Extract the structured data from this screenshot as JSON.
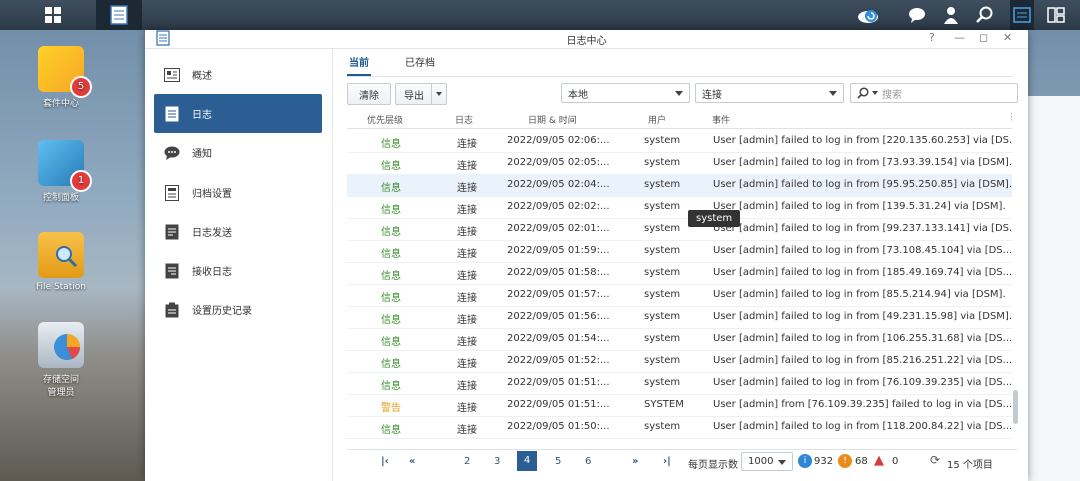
{
  "desktop": {
    "icons": [
      {
        "label": "套件中心",
        "badge": "5"
      },
      {
        "label": "控制面板",
        "badge": "1"
      },
      {
        "label": "File Station",
        "badge": ""
      },
      {
        "label": "存储空间\n管理员",
        "badge": ""
      }
    ]
  },
  "window": {
    "title": "日志中心",
    "sidebar": [
      {
        "label": "概述",
        "icon": "overview-icon"
      },
      {
        "label": "日志",
        "icon": "log-icon"
      },
      {
        "label": "通知",
        "icon": "chat-icon"
      },
      {
        "label": "归档设置",
        "icon": "archive-icon"
      },
      {
        "label": "日志发送",
        "icon": "send-icon"
      },
      {
        "label": "接收日志",
        "icon": "receive-icon"
      },
      {
        "label": "设置历史记录",
        "icon": "history-icon"
      }
    ],
    "tabs": [
      "当前",
      "已存档"
    ],
    "toolbar": {
      "clear_label": "清除",
      "export_label": "导出",
      "source_value": "本地",
      "type_value": "连接",
      "search_placeholder": "搜索"
    },
    "columns": [
      "优先层级",
      "日志",
      "日期 & 时间",
      "用户",
      "事件"
    ],
    "rows": [
      {
        "level": "信息",
        "log": "连接",
        "time": "2022/09/05 02:06:...",
        "user": "system",
        "event": "User [admin] failed to log in from [220.135.60.253] via [DS..."
      },
      {
        "level": "信息",
        "log": "连接",
        "time": "2022/09/05 02:05:...",
        "user": "system",
        "event": "User [admin] failed to log in from [73.93.39.154] via [DSM]."
      },
      {
        "level": "信息",
        "log": "连接",
        "time": "2022/09/05 02:04:...",
        "user": "system",
        "event": "User [admin] failed to log in from [95.95.250.85] via [DSM]."
      },
      {
        "level": "信息",
        "log": "连接",
        "time": "2022/09/05 02:02:...",
        "user": "system",
        "event": "User [admin] failed to log in from [139.5.31.24] via [DSM]."
      },
      {
        "level": "信息",
        "log": "连接",
        "time": "2022/09/05 02:01:...",
        "user": "system",
        "event": "User [admin] failed to log in from [99.237.133.141] via [DS..."
      },
      {
        "level": "信息",
        "log": "连接",
        "time": "2022/09/05 01:59:...",
        "user": "system",
        "event": "User [admin] failed to log in from [73.108.45.104] via [DS..."
      },
      {
        "level": "信息",
        "log": "连接",
        "time": "2022/09/05 01:58:...",
        "user": "system",
        "event": "User [admin] failed to log in from [185.49.169.74] via [DS..."
      },
      {
        "level": "信息",
        "log": "连接",
        "time": "2022/09/05 01:57:...",
        "user": "system",
        "event": "User [admin] failed to log in from [85.5.214.94] via [DSM]."
      },
      {
        "level": "信息",
        "log": "连接",
        "time": "2022/09/05 01:56:...",
        "user": "system",
        "event": "User [admin] failed to log in from [49.231.15.98] via [DSM]."
      },
      {
        "level": "信息",
        "log": "连接",
        "time": "2022/09/05 01:54:...",
        "user": "system",
        "event": "User [admin] failed to log in from [106.255.31.68] via [DS..."
      },
      {
        "level": "信息",
        "log": "连接",
        "time": "2022/09/05 01:52:...",
        "user": "system",
        "event": "User [admin] failed to log in from [85.216.251.22] via [DS..."
      },
      {
        "level": "信息",
        "log": "连接",
        "time": "2022/09/05 01:51:...",
        "user": "system",
        "event": "User [admin] failed to log in from [76.109.39.235] via [DS..."
      },
      {
        "level": "警告",
        "log": "连接",
        "time": "2022/09/05 01:51:...",
        "user": "SYSTEM",
        "event": "User [admin] from [76.109.39.235] failed to log in via [DS..."
      },
      {
        "level": "信息",
        "log": "连接",
        "time": "2022/09/05 01:50:...",
        "user": "system",
        "event": "User [admin] failed to log in from [118.200.84.22] via [DS..."
      }
    ],
    "tooltip": "system",
    "pager": {
      "pages": [
        "2",
        "3",
        "4",
        "5",
        "6"
      ],
      "current": "4",
      "per_page_label": "每页显示数",
      "per_page_value": "1000",
      "info_count": "932",
      "warn_count": "68",
      "error_count": "0",
      "total": "15 个项目"
    }
  },
  "colors": {
    "accent": "#2b5e92",
    "info": "#3a8b2d",
    "warn": "#e09b16",
    "error": "#d63a3a"
  }
}
